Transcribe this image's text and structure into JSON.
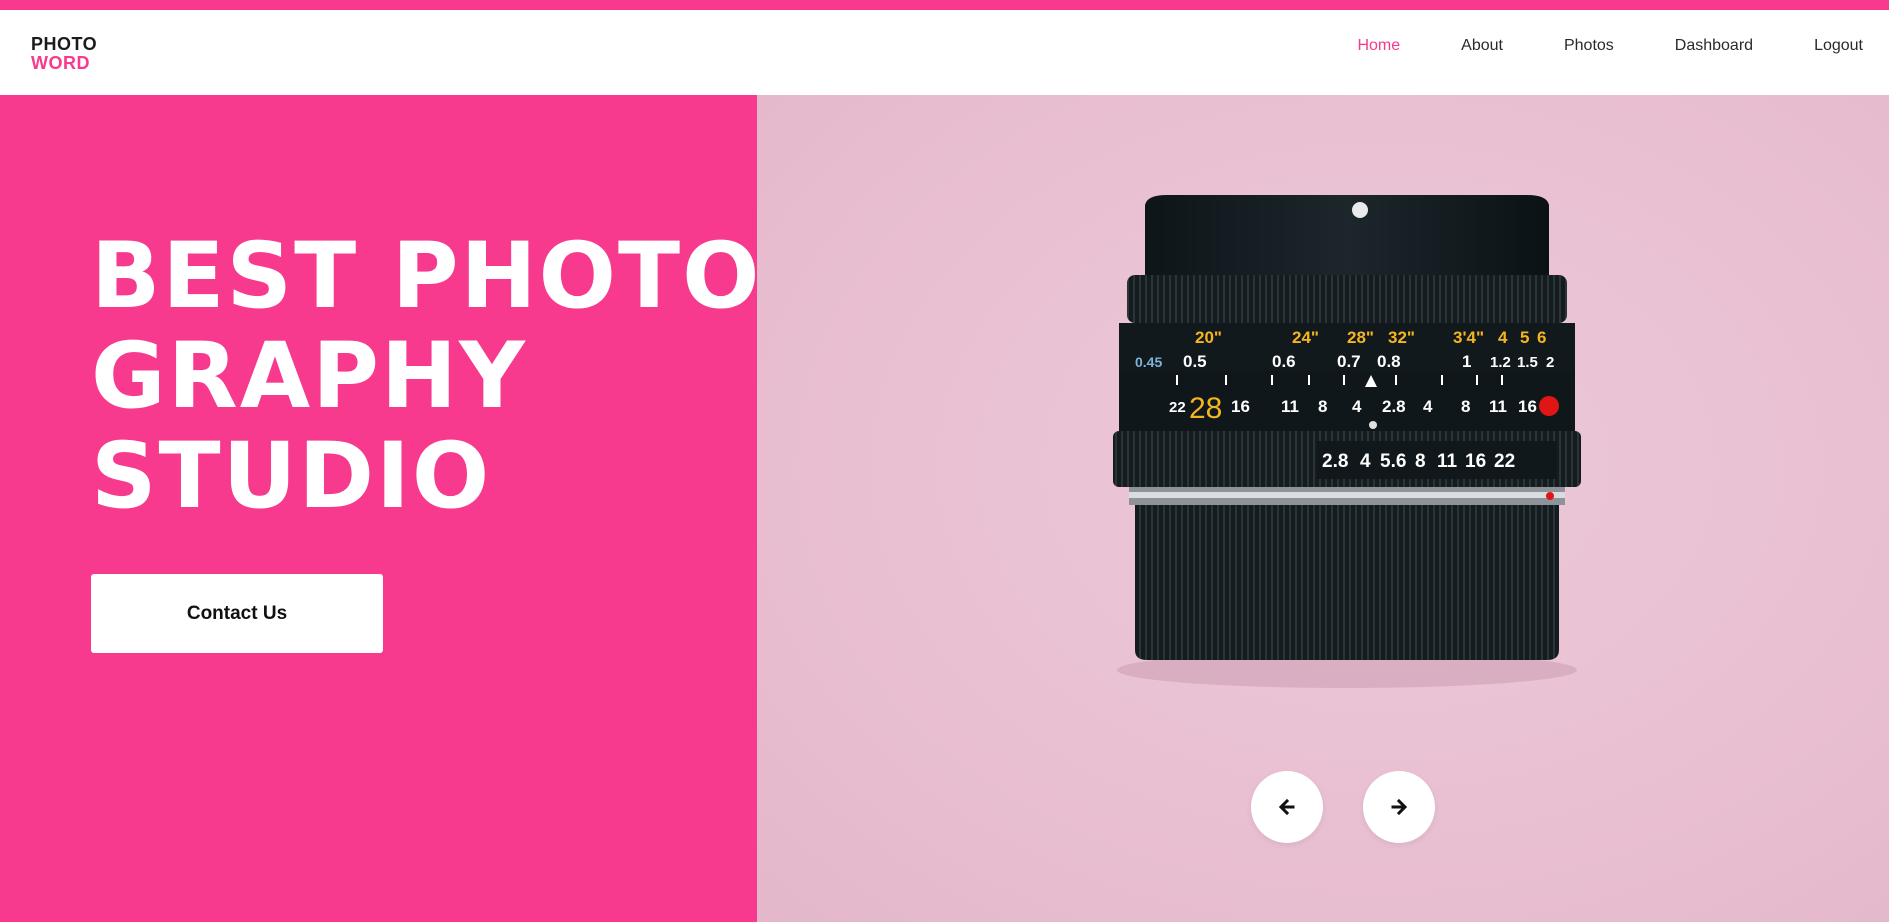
{
  "brand": {
    "line1": "PHOTO",
    "line2": "WORD"
  },
  "nav": {
    "items": [
      {
        "label": "Home",
        "active": true
      },
      {
        "label": "About",
        "active": false
      },
      {
        "label": "Photos",
        "active": false
      },
      {
        "label": "Dashboard",
        "active": false
      },
      {
        "label": "Logout",
        "active": false
      }
    ]
  },
  "hero": {
    "headline_lines": [
      "BEST PHOTO",
      "GRAPHY",
      "STUDIO"
    ],
    "cta_label": "Contact Us"
  },
  "slider": {
    "prev_icon": "arrow-left-icon",
    "next_icon": "arrow-right-icon"
  },
  "lens_markings": {
    "feet_row": [
      "20\"",
      "24\"",
      "28\"",
      "32\"",
      "3'4\"",
      "4",
      "5",
      "6"
    ],
    "meter_row": [
      "0.45",
      "0.5",
      "0.6",
      "0.7",
      "0.8",
      "1",
      "1.2",
      "1.5",
      "2"
    ],
    "dof_row": [
      "22",
      "28",
      "16",
      "11",
      "8",
      "4",
      "2.8",
      "4",
      "8",
      "11",
      "16"
    ],
    "aperture_row": [
      "2.8",
      "4",
      "5.6",
      "8",
      "11",
      "16",
      "22"
    ]
  },
  "colors": {
    "accent": "#f73a8e",
    "panel_bg": "#e8bfd1",
    "lens_yellow": "#f5b51f"
  }
}
